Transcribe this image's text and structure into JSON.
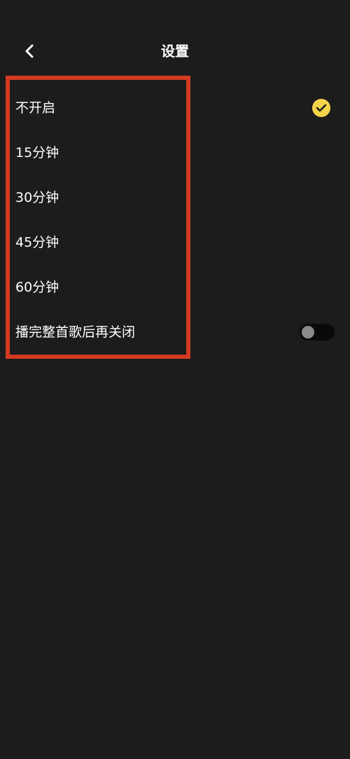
{
  "header": {
    "title": "设置",
    "back_icon": "chevron-left-icon"
  },
  "options": [
    {
      "label": "不开启",
      "selected": true
    },
    {
      "label": "15分钟",
      "selected": false
    },
    {
      "label": "30分钟",
      "selected": false
    },
    {
      "label": "45分钟",
      "selected": false
    },
    {
      "label": "60分钟",
      "selected": false
    }
  ],
  "finish_song": {
    "label": "播完整首歌后再关闭",
    "enabled": false
  },
  "colors": {
    "background": "#1c1c1c",
    "check_accent": "#f5d44a",
    "highlight_border": "#d33a20",
    "toggle_track": "#0a0a0a",
    "toggle_knob": "#8a8a8a"
  }
}
